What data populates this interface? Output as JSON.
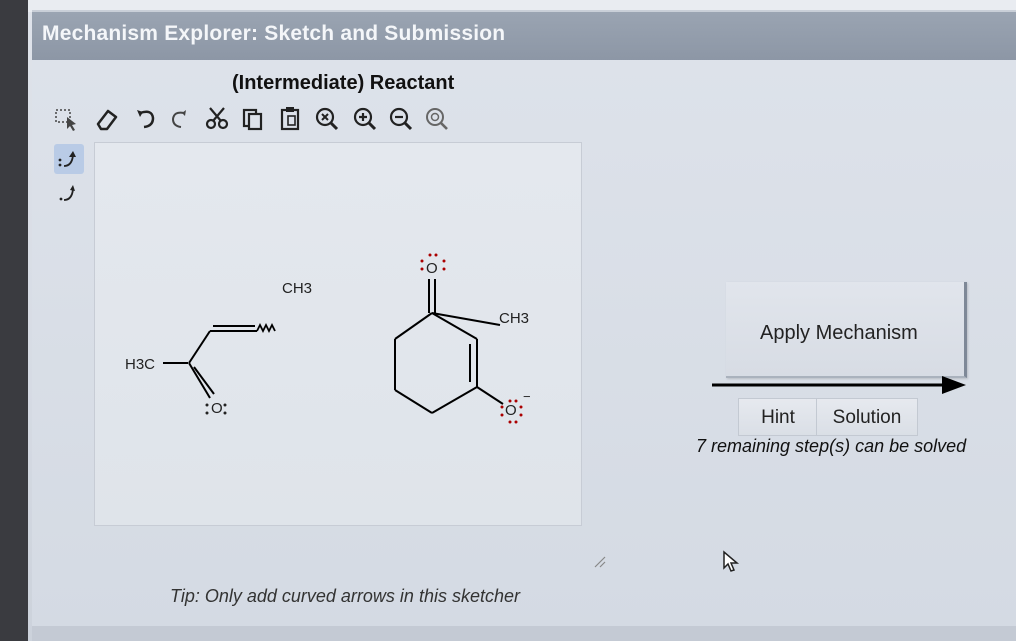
{
  "window": {
    "title": "Mechanism Explorer: Sketch and Submission"
  },
  "sketcher": {
    "label": "(Intermediate) Reactant",
    "toolbar": [
      {
        "name": "select-tool",
        "icon": "lasso-select-icon"
      },
      {
        "name": "erase-tool",
        "icon": "eraser-icon"
      },
      {
        "name": "undo-tool",
        "icon": "undo-icon"
      },
      {
        "name": "redo-tool",
        "icon": "redo-icon"
      },
      {
        "name": "cut-tool",
        "icon": "scissors-icon"
      },
      {
        "name": "copy-tool",
        "icon": "copy-icon"
      },
      {
        "name": "paste-tool",
        "icon": "paste-icon"
      },
      {
        "name": "zoom-fit-tool",
        "icon": "zoom-fit-icon"
      },
      {
        "name": "zoom-in-tool",
        "icon": "zoom-in-icon"
      },
      {
        "name": "zoom-out-tool",
        "icon": "zoom-out-icon"
      },
      {
        "name": "zoom-reset-tool",
        "icon": "zoom-reset-icon"
      }
    ],
    "arrow_tools": [
      {
        "name": "electron-pair-arrow",
        "icon": "curved-arrow-pair-icon",
        "active": true
      },
      {
        "name": "single-electron-arrow",
        "icon": "curved-arrow-single-icon",
        "active": false
      }
    ],
    "molecules": {
      "enone": {
        "left_group": "H3C",
        "left_sub": "3",
        "top_group": "CH3",
        "top_sub": "3",
        "oxygen": "O"
      },
      "enolate": {
        "methyl": "CH3",
        "methyl_sub": "3",
        "carbonyl_oxygen": "O",
        "enolate_oxygen": "O",
        "charge": "−"
      }
    },
    "tip": "Tip: Only add curved arrows in this sketcher"
  },
  "actions": {
    "apply_label": "Apply Mechanism",
    "hint_label": "Hint",
    "solution_label": "Solution",
    "remaining": "7 remaining step(s) can be solved"
  }
}
